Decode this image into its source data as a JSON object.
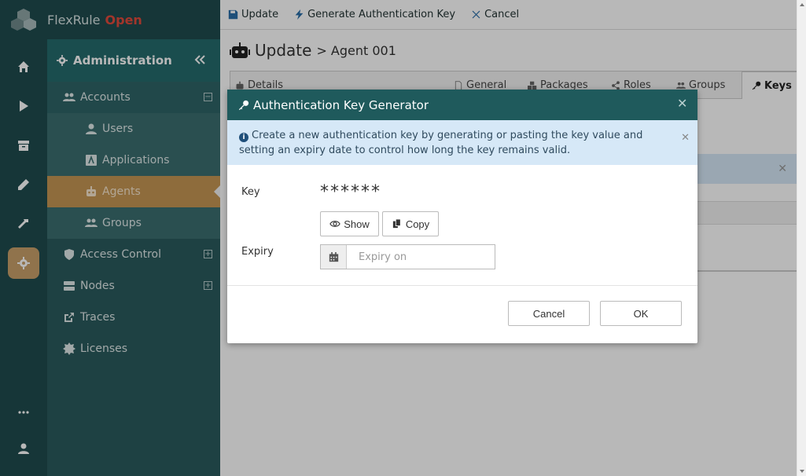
{
  "brand": {
    "name": "FlexRule",
    "edition": "Open"
  },
  "sidebar": {
    "section_title": "Administration",
    "items": [
      {
        "label": "Accounts"
      },
      {
        "label": "Users"
      },
      {
        "label": "Applications"
      },
      {
        "label": "Agents"
      },
      {
        "label": "Groups"
      },
      {
        "label": "Access Control"
      },
      {
        "label": "Nodes"
      },
      {
        "label": "Traces"
      },
      {
        "label": "Licenses"
      }
    ]
  },
  "toolbar": {
    "update_label": "Update",
    "generate_label": "Generate Authentication Key",
    "cancel_label": "Cancel"
  },
  "page": {
    "title": "Update",
    "subtitle": "> Agent 001"
  },
  "tabs": [
    "Details",
    "General",
    "Packages",
    "Roles",
    "Groups",
    "Keys"
  ],
  "modal": {
    "title": "Authentication Key Generator",
    "info_text": "Create a new authentication key by generating or pasting the key value and setting an expiry date to control how long the key remains valid.",
    "key_label": "Key",
    "key_value": "******",
    "show_label": "Show",
    "copy_label": "Copy",
    "expiry_label": "Expiry",
    "expiry_placeholder": "Expiry on",
    "cancel_label": "Cancel",
    "ok_label": "OK"
  },
  "colors": {
    "rail": "#1f4c4e",
    "header": "#1f5a5c",
    "accent": "#c8a06a",
    "info_bg": "#d6e8f7",
    "brand_open": "#e24a3c"
  }
}
